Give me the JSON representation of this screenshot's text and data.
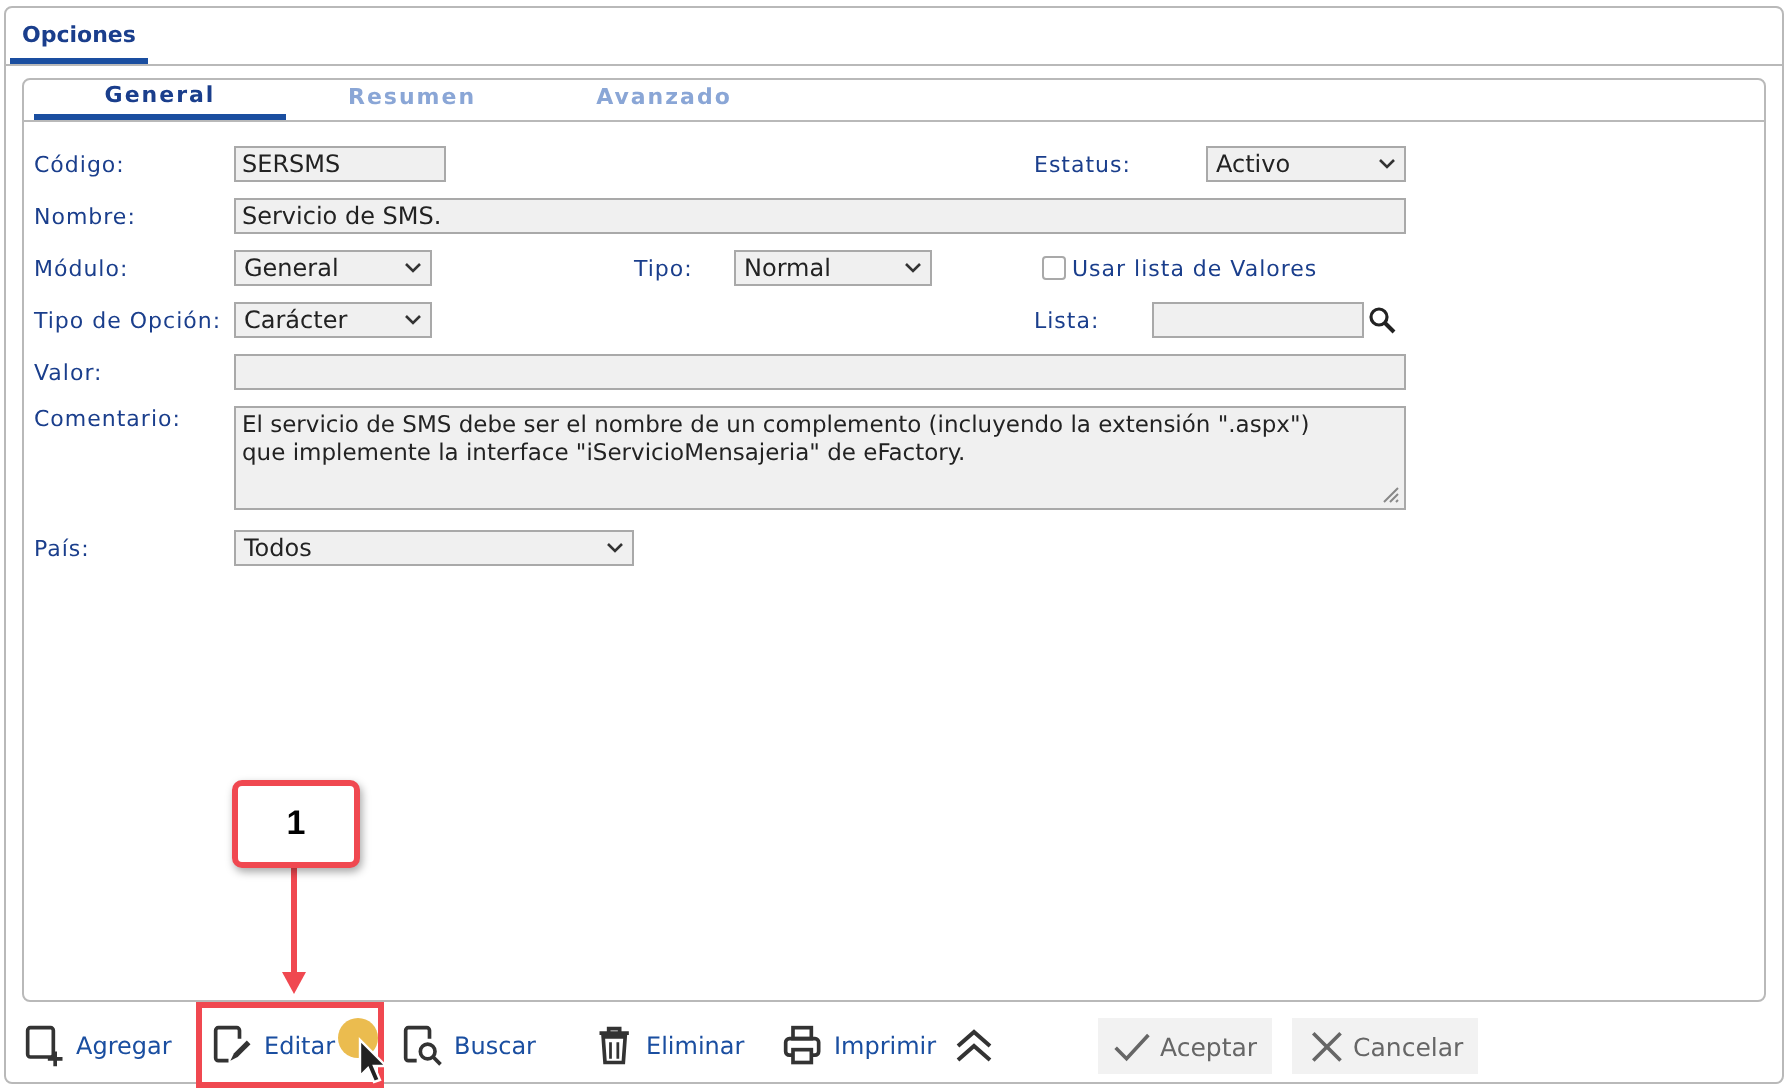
{
  "tab": {
    "label": "Opciones",
    "selected": true
  },
  "subtabs": [
    {
      "label": "General",
      "selected": true
    },
    {
      "label": "Resumen",
      "selected": false
    },
    {
      "label": "Avanzado",
      "selected": false
    }
  ],
  "form": {
    "codigo": {
      "label": "Código:",
      "value": "SERSMS"
    },
    "estatus": {
      "label": "Estatus:",
      "value": "Activo"
    },
    "nombre": {
      "label": "Nombre:",
      "value": "Servicio de SMS."
    },
    "modulo": {
      "label": "Módulo:",
      "value": "General"
    },
    "tipo": {
      "label": "Tipo:",
      "value": "Normal"
    },
    "usar_lista": {
      "label": "Usar lista de Valores",
      "checked": false
    },
    "tipo_opcion": {
      "label": "Tipo de Opción:",
      "value": "Carácter"
    },
    "lista": {
      "label": "Lista:"
    },
    "valor": {
      "label": "Valor:"
    },
    "comentario": {
      "label": "Comentario:",
      "value": "El servicio de SMS debe ser el nombre de un complemento (incluyendo la extensión \".aspx\") que implemente la interface \"iServicioMensajeria\" de eFactory."
    },
    "pais": {
      "label": "País:",
      "value": "Todos"
    }
  },
  "toolbar": [
    {
      "kind": "add",
      "label": "Agregar",
      "disabled": false
    },
    {
      "kind": "edit",
      "label": "Editar",
      "disabled": false
    },
    {
      "kind": "search",
      "label": "Buscar",
      "disabled": false
    },
    {
      "kind": "delete",
      "label": "Eliminar",
      "disabled": false
    },
    {
      "kind": "print",
      "label": "Imprimir",
      "disabled": false
    }
  ],
  "actions": [
    {
      "kind": "accept",
      "label": "Aceptar",
      "disabled": true
    },
    {
      "kind": "cancel",
      "label": "Cancelar",
      "disabled": true
    }
  ],
  "callout": {
    "label": "1"
  }
}
